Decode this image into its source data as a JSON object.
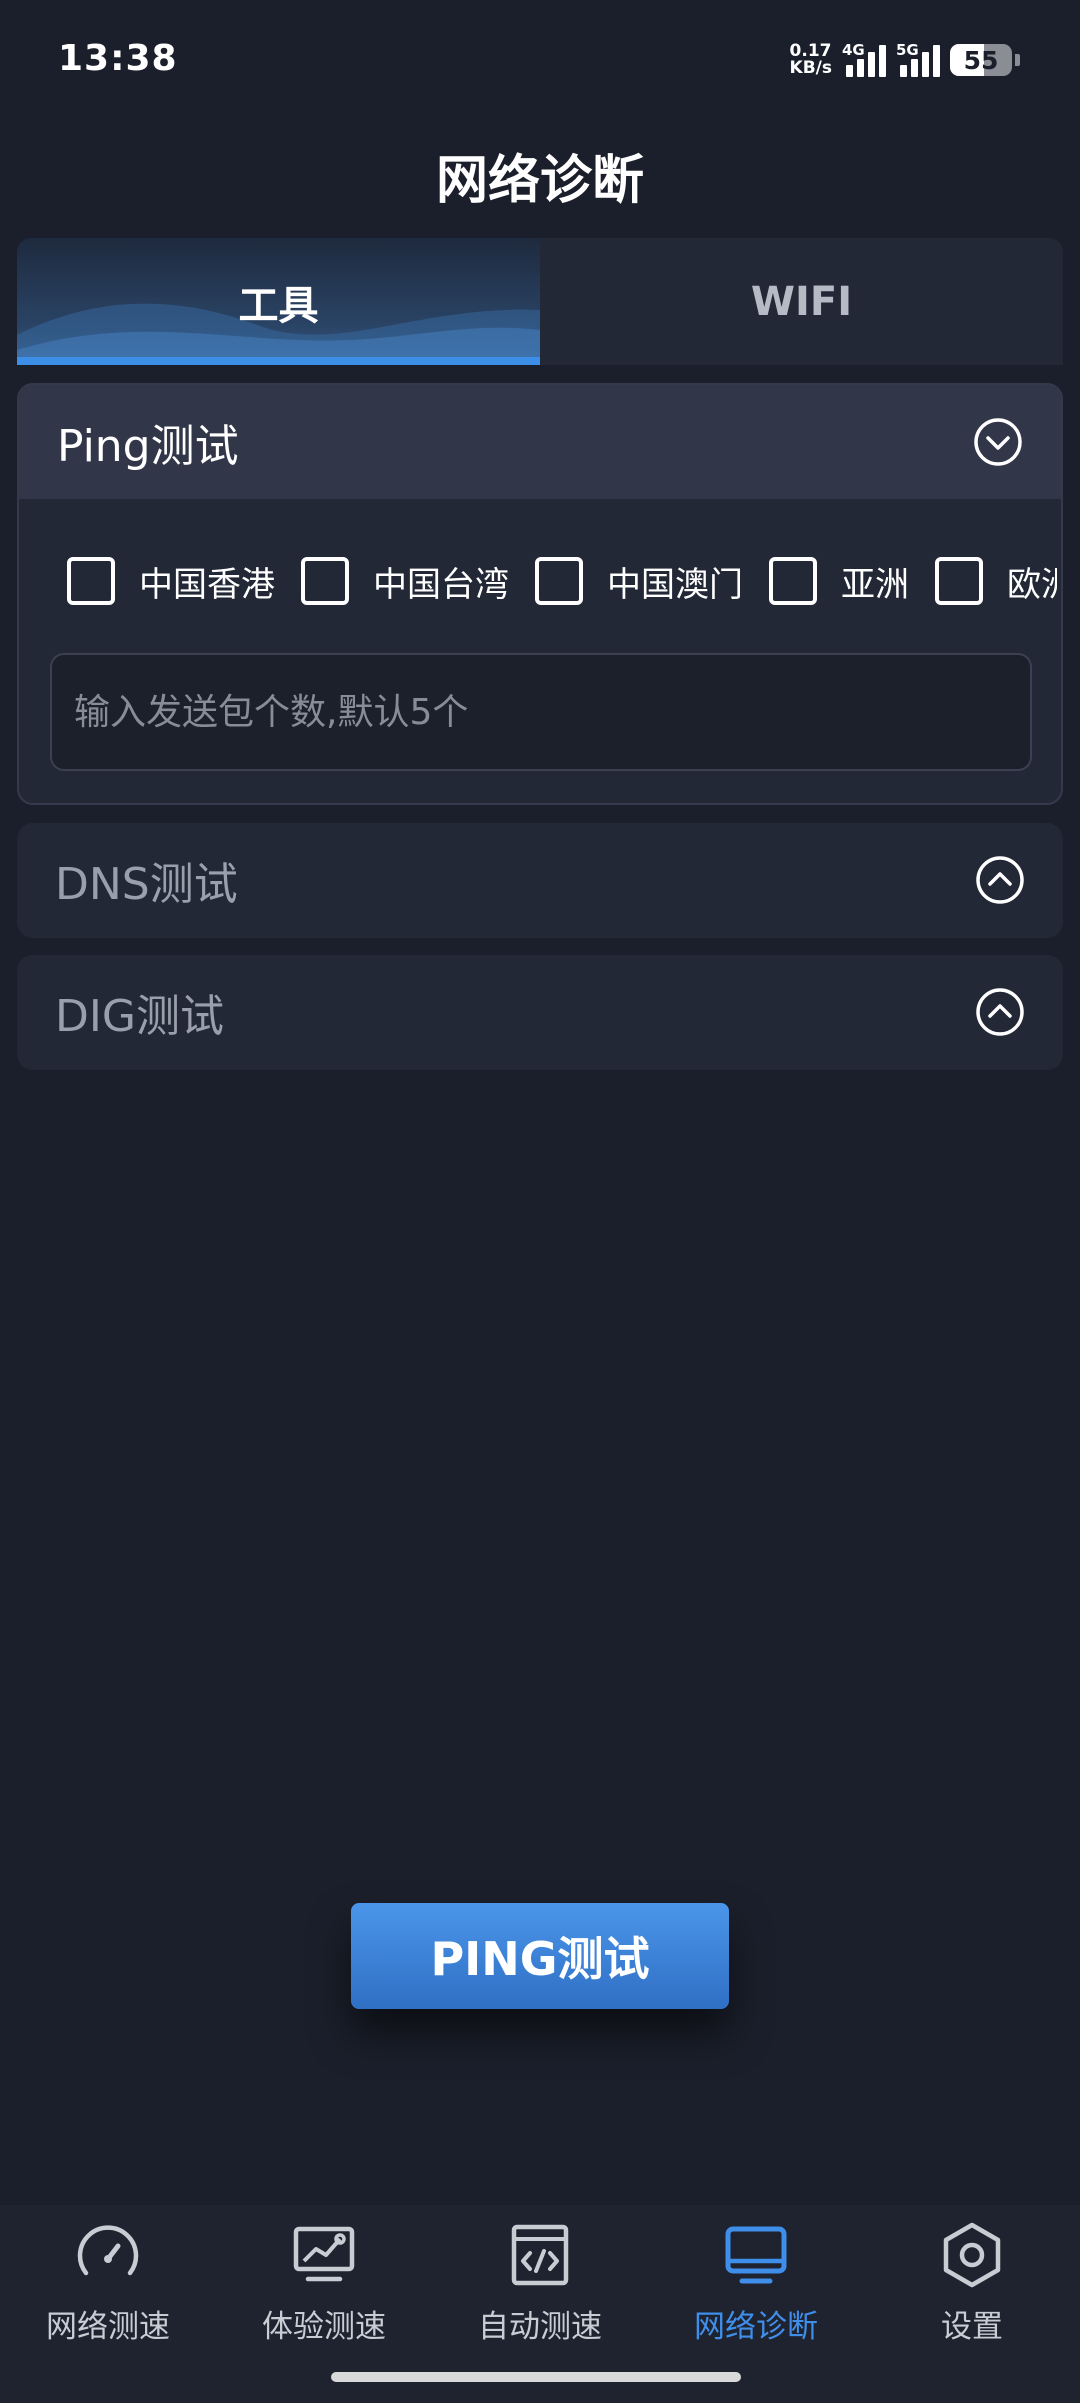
{
  "status_bar": {
    "time": "13:38",
    "speed_value": "0.17",
    "speed_unit": "KB/s",
    "network1": "4G",
    "network2": "5G",
    "battery": "55"
  },
  "header": {
    "title": "网络诊断"
  },
  "tabs": [
    {
      "label": "工具",
      "active": true
    },
    {
      "label": "WIFI",
      "active": false
    }
  ],
  "ping_panel": {
    "title": "Ping测试",
    "expand_icon": "chevron-down-circle-icon",
    "regions": [
      {
        "label": "中国香港",
        "checked": false
      },
      {
        "label": "中国台湾",
        "checked": false
      },
      {
        "label": "中国澳门",
        "checked": false
      },
      {
        "label": "亚洲",
        "checked": false
      },
      {
        "label": "欧洲",
        "checked": false
      }
    ],
    "count_input": {
      "value": "",
      "placeholder": "输入发送包个数,默认5个"
    }
  },
  "dns_panel": {
    "title": "DNS测试",
    "expand_icon": "chevron-up-circle-icon"
  },
  "dig_panel": {
    "title": "DIG测试",
    "expand_icon": "chevron-up-circle-icon"
  },
  "action_button": {
    "label": "PING测试"
  },
  "bottom_nav": [
    {
      "label": "网络测速",
      "icon": "speedometer-icon",
      "active": false
    },
    {
      "label": "体验测速",
      "icon": "chart-monitor-icon",
      "active": false
    },
    {
      "label": "自动测速",
      "icon": "code-window-icon",
      "active": false
    },
    {
      "label": "网络诊断",
      "icon": "desktop-icon",
      "active": true
    },
    {
      "label": "设置",
      "icon": "hexagon-settings-icon",
      "active": false
    }
  ],
  "colors": {
    "background": "#1b1f2b",
    "panel": "#232837",
    "accent": "#3d8ee6",
    "button": "#3a7fd6"
  }
}
